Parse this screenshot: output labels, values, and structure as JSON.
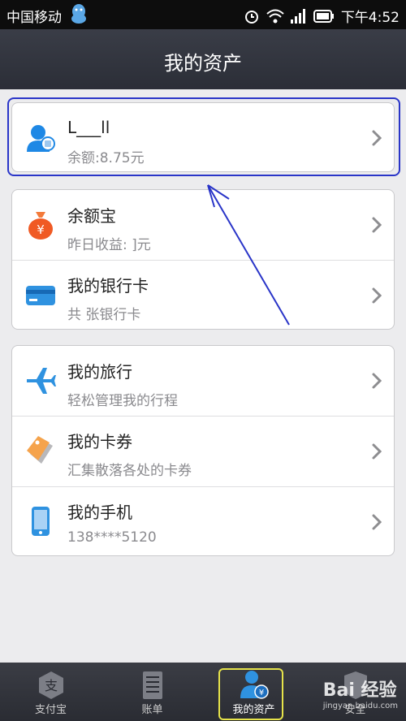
{
  "status_bar": {
    "carrier": "中国移动",
    "time": "下午4:52"
  },
  "header": {
    "title": "我的资产"
  },
  "account": {
    "name": "L___ll",
    "balance": "余额:8.75元"
  },
  "groups": [
    {
      "items": [
        {
          "label": "余额宝",
          "sub": "昨日收益:  ]元",
          "icon": "money-bag-icon"
        },
        {
          "label": "我的银行卡",
          "sub": "共  张银行卡",
          "icon": "bank-card-icon"
        }
      ]
    },
    {
      "items": [
        {
          "label": "我的旅行",
          "sub": "轻松管理我的行程",
          "icon": "airplane-icon"
        },
        {
          "label": "我的卡券",
          "sub": "汇集散落各处的卡券",
          "icon": "coupon-tag-icon"
        },
        {
          "label": "我的手机",
          "sub": "138****5120",
          "icon": "mobile-phone-icon"
        }
      ]
    }
  ],
  "tabs": [
    {
      "label": "支付宝",
      "icon": "alipay-icon"
    },
    {
      "label": "账单",
      "icon": "bill-icon"
    },
    {
      "label": "我的资产",
      "icon": "assets-icon",
      "active": true
    },
    {
      "label": "安全",
      "icon": "security-icon"
    }
  ],
  "watermark": {
    "main": "Bai 经验",
    "sub": "jingyan.baidu.com"
  },
  "colors": {
    "accent_blue": "#1e88e5",
    "annotation_blue": "#2a35c8",
    "tab_highlight": "#e6e34a"
  }
}
